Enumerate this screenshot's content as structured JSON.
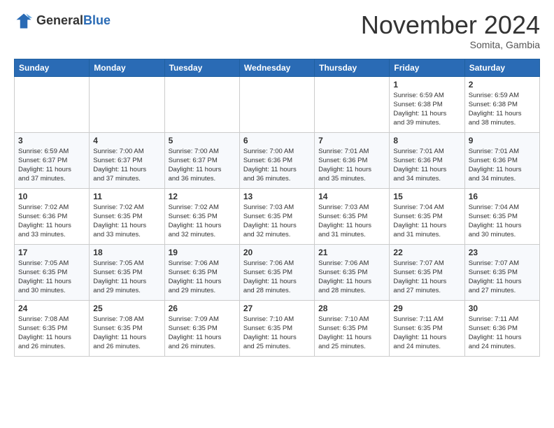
{
  "header": {
    "logo_general": "General",
    "logo_blue": "Blue",
    "month": "November 2024",
    "location": "Somita, Gambia"
  },
  "weekdays": [
    "Sunday",
    "Monday",
    "Tuesday",
    "Wednesday",
    "Thursday",
    "Friday",
    "Saturday"
  ],
  "weeks": [
    [
      {
        "day": "",
        "info": ""
      },
      {
        "day": "",
        "info": ""
      },
      {
        "day": "",
        "info": ""
      },
      {
        "day": "",
        "info": ""
      },
      {
        "day": "",
        "info": ""
      },
      {
        "day": "1",
        "info": "Sunrise: 6:59 AM\nSunset: 6:38 PM\nDaylight: 11 hours\nand 39 minutes."
      },
      {
        "day": "2",
        "info": "Sunrise: 6:59 AM\nSunset: 6:38 PM\nDaylight: 11 hours\nand 38 minutes."
      }
    ],
    [
      {
        "day": "3",
        "info": "Sunrise: 6:59 AM\nSunset: 6:37 PM\nDaylight: 11 hours\nand 37 minutes."
      },
      {
        "day": "4",
        "info": "Sunrise: 7:00 AM\nSunset: 6:37 PM\nDaylight: 11 hours\nand 37 minutes."
      },
      {
        "day": "5",
        "info": "Sunrise: 7:00 AM\nSunset: 6:37 PM\nDaylight: 11 hours\nand 36 minutes."
      },
      {
        "day": "6",
        "info": "Sunrise: 7:00 AM\nSunset: 6:36 PM\nDaylight: 11 hours\nand 36 minutes."
      },
      {
        "day": "7",
        "info": "Sunrise: 7:01 AM\nSunset: 6:36 PM\nDaylight: 11 hours\nand 35 minutes."
      },
      {
        "day": "8",
        "info": "Sunrise: 7:01 AM\nSunset: 6:36 PM\nDaylight: 11 hours\nand 34 minutes."
      },
      {
        "day": "9",
        "info": "Sunrise: 7:01 AM\nSunset: 6:36 PM\nDaylight: 11 hours\nand 34 minutes."
      }
    ],
    [
      {
        "day": "10",
        "info": "Sunrise: 7:02 AM\nSunset: 6:36 PM\nDaylight: 11 hours\nand 33 minutes."
      },
      {
        "day": "11",
        "info": "Sunrise: 7:02 AM\nSunset: 6:35 PM\nDaylight: 11 hours\nand 33 minutes."
      },
      {
        "day": "12",
        "info": "Sunrise: 7:02 AM\nSunset: 6:35 PM\nDaylight: 11 hours\nand 32 minutes."
      },
      {
        "day": "13",
        "info": "Sunrise: 7:03 AM\nSunset: 6:35 PM\nDaylight: 11 hours\nand 32 minutes."
      },
      {
        "day": "14",
        "info": "Sunrise: 7:03 AM\nSunset: 6:35 PM\nDaylight: 11 hours\nand 31 minutes."
      },
      {
        "day": "15",
        "info": "Sunrise: 7:04 AM\nSunset: 6:35 PM\nDaylight: 11 hours\nand 31 minutes."
      },
      {
        "day": "16",
        "info": "Sunrise: 7:04 AM\nSunset: 6:35 PM\nDaylight: 11 hours\nand 30 minutes."
      }
    ],
    [
      {
        "day": "17",
        "info": "Sunrise: 7:05 AM\nSunset: 6:35 PM\nDaylight: 11 hours\nand 30 minutes."
      },
      {
        "day": "18",
        "info": "Sunrise: 7:05 AM\nSunset: 6:35 PM\nDaylight: 11 hours\nand 29 minutes."
      },
      {
        "day": "19",
        "info": "Sunrise: 7:06 AM\nSunset: 6:35 PM\nDaylight: 11 hours\nand 29 minutes."
      },
      {
        "day": "20",
        "info": "Sunrise: 7:06 AM\nSunset: 6:35 PM\nDaylight: 11 hours\nand 28 minutes."
      },
      {
        "day": "21",
        "info": "Sunrise: 7:06 AM\nSunset: 6:35 PM\nDaylight: 11 hours\nand 28 minutes."
      },
      {
        "day": "22",
        "info": "Sunrise: 7:07 AM\nSunset: 6:35 PM\nDaylight: 11 hours\nand 27 minutes."
      },
      {
        "day": "23",
        "info": "Sunrise: 7:07 AM\nSunset: 6:35 PM\nDaylight: 11 hours\nand 27 minutes."
      }
    ],
    [
      {
        "day": "24",
        "info": "Sunrise: 7:08 AM\nSunset: 6:35 PM\nDaylight: 11 hours\nand 26 minutes."
      },
      {
        "day": "25",
        "info": "Sunrise: 7:08 AM\nSunset: 6:35 PM\nDaylight: 11 hours\nand 26 minutes."
      },
      {
        "day": "26",
        "info": "Sunrise: 7:09 AM\nSunset: 6:35 PM\nDaylight: 11 hours\nand 26 minutes."
      },
      {
        "day": "27",
        "info": "Sunrise: 7:10 AM\nSunset: 6:35 PM\nDaylight: 11 hours\nand 25 minutes."
      },
      {
        "day": "28",
        "info": "Sunrise: 7:10 AM\nSunset: 6:35 PM\nDaylight: 11 hours\nand 25 minutes."
      },
      {
        "day": "29",
        "info": "Sunrise: 7:11 AM\nSunset: 6:35 PM\nDaylight: 11 hours\nand 24 minutes."
      },
      {
        "day": "30",
        "info": "Sunrise: 7:11 AM\nSunset: 6:36 PM\nDaylight: 11 hours\nand 24 minutes."
      }
    ]
  ]
}
